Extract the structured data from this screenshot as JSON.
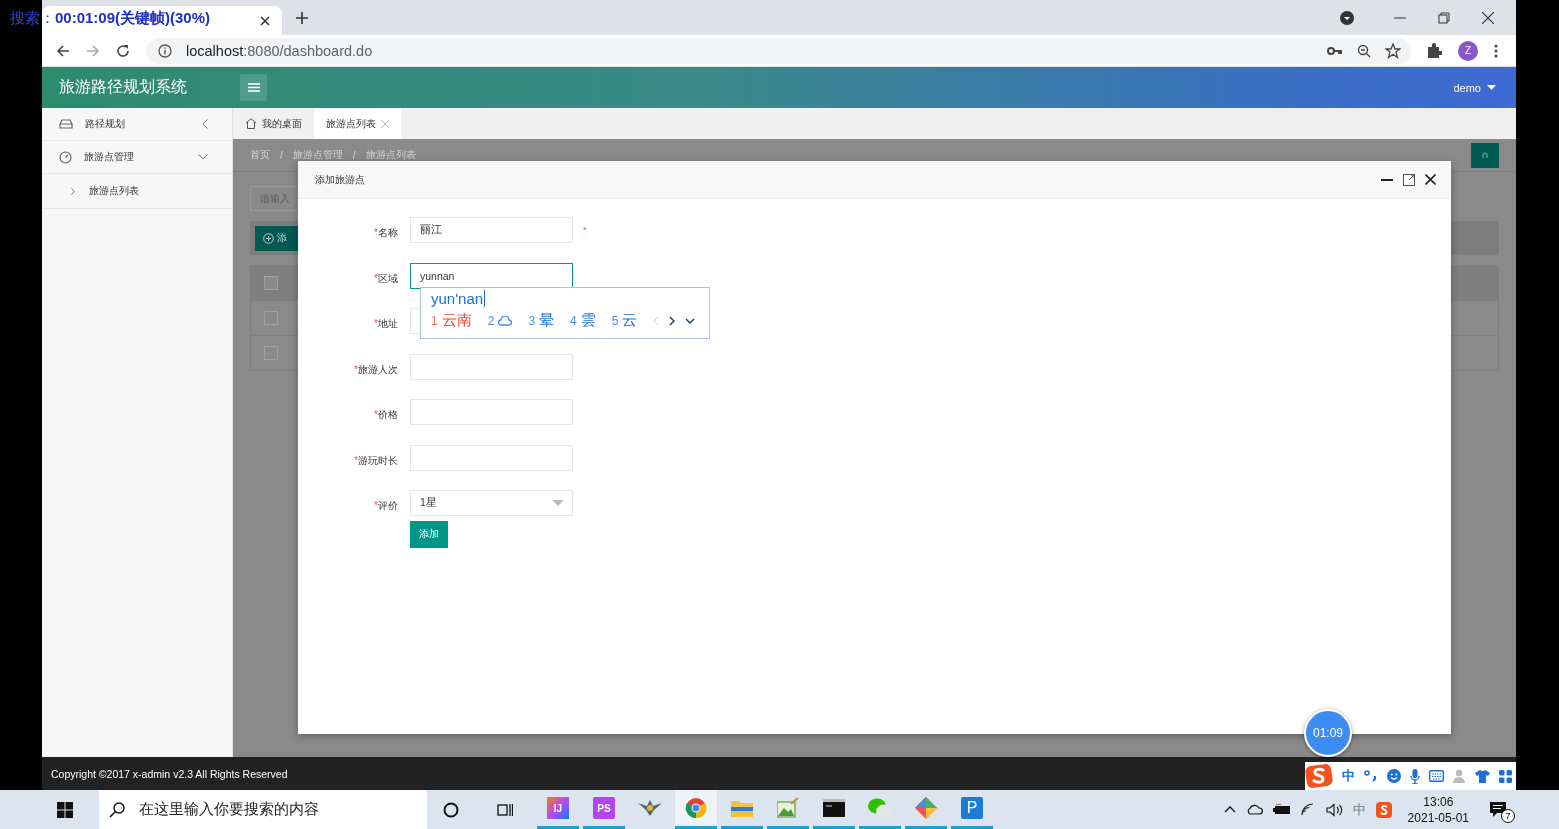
{
  "recorder_overlay": {
    "label": "搜索：",
    "time": "00:01:09(关键帧)(30%)"
  },
  "browser": {
    "url_host": "localhost",
    "url_path": ":8080/dashboard.do",
    "avatar": "Z"
  },
  "app": {
    "title": "旅游路径规划系统",
    "user": "demo"
  },
  "sidebar": {
    "items": [
      {
        "label": "路径规划",
        "expanded": false
      },
      {
        "label": "旅游点管理",
        "expanded": true,
        "children": [
          {
            "label": "旅游点列表"
          }
        ]
      }
    ]
  },
  "tabs": [
    {
      "label": "我的桌面",
      "selected": false,
      "closable": false
    },
    {
      "label": "旅游点列表",
      "selected": true,
      "closable": true
    }
  ],
  "breadcrumb": {
    "separator": "/",
    "items": [
      "首页",
      "旅游点管理",
      "旅游点列表"
    ]
  },
  "list_page": {
    "search_placeholder": "请输入",
    "add_button": "添",
    "checkboxes": [
      {
        "checked": false
      },
      {
        "checked": false
      },
      {
        "checked": false
      }
    ]
  },
  "dialog": {
    "title": "添加旅游点",
    "required_mark": "*",
    "fields": [
      {
        "label": "名称",
        "kind": "text",
        "value": "丽江",
        "focused": false,
        "note": "*"
      },
      {
        "label": "区域",
        "kind": "text",
        "value": "yunnan",
        "focused": true
      },
      {
        "label": "地址",
        "kind": "text",
        "focused": false
      },
      {
        "label": "旅游人次",
        "kind": "text",
        "focused": false
      },
      {
        "label": "价格",
        "kind": "text",
        "focused": false
      },
      {
        "label": "游玩时长",
        "kind": "text",
        "focused": false
      },
      {
        "label": "评价",
        "kind": "select",
        "value": "1星",
        "focused": false
      }
    ],
    "submit": "添加"
  },
  "ime_popup": {
    "composition": "yun'nan",
    "candidates": [
      {
        "index": "1",
        "kind": "text",
        "text": "云南",
        "selected": true
      },
      {
        "index": "2",
        "kind": "emoji",
        "selected": false
      },
      {
        "index": "3",
        "kind": "text",
        "text": "晕",
        "selected": false
      },
      {
        "index": "4",
        "kind": "text",
        "text": "雲",
        "selected": false
      },
      {
        "index": "5",
        "kind": "text",
        "text": "云",
        "selected": false
      }
    ]
  },
  "recording_timer": "01:09",
  "footer": {
    "copyright": "Copyright ©2017 x-admin v2.3 All Rights Reserved"
  },
  "ime_toolbar": {
    "mode": "中"
  },
  "taskbar": {
    "search_placeholder": "在这里输入你要搜索的内容",
    "apps": [
      {
        "kind": "intellij",
        "glyph": "IJ",
        "running": true
      },
      {
        "kind": "phpstorm",
        "glyph": "PS",
        "running": true
      },
      {
        "kind": "game",
        "running": false
      },
      {
        "kind": "chrome",
        "running": true
      },
      {
        "kind": "folder",
        "running": true
      },
      {
        "kind": "picture",
        "running": true
      },
      {
        "kind": "terminal",
        "running": true
      },
      {
        "kind": "chat",
        "running": true
      },
      {
        "kind": "git",
        "running": true
      },
      {
        "kind": "p",
        "glyph": "P",
        "running": true
      }
    ],
    "tray_ime": "中",
    "time": "13:06",
    "date": "2021-05-01",
    "notifications": "7"
  }
}
